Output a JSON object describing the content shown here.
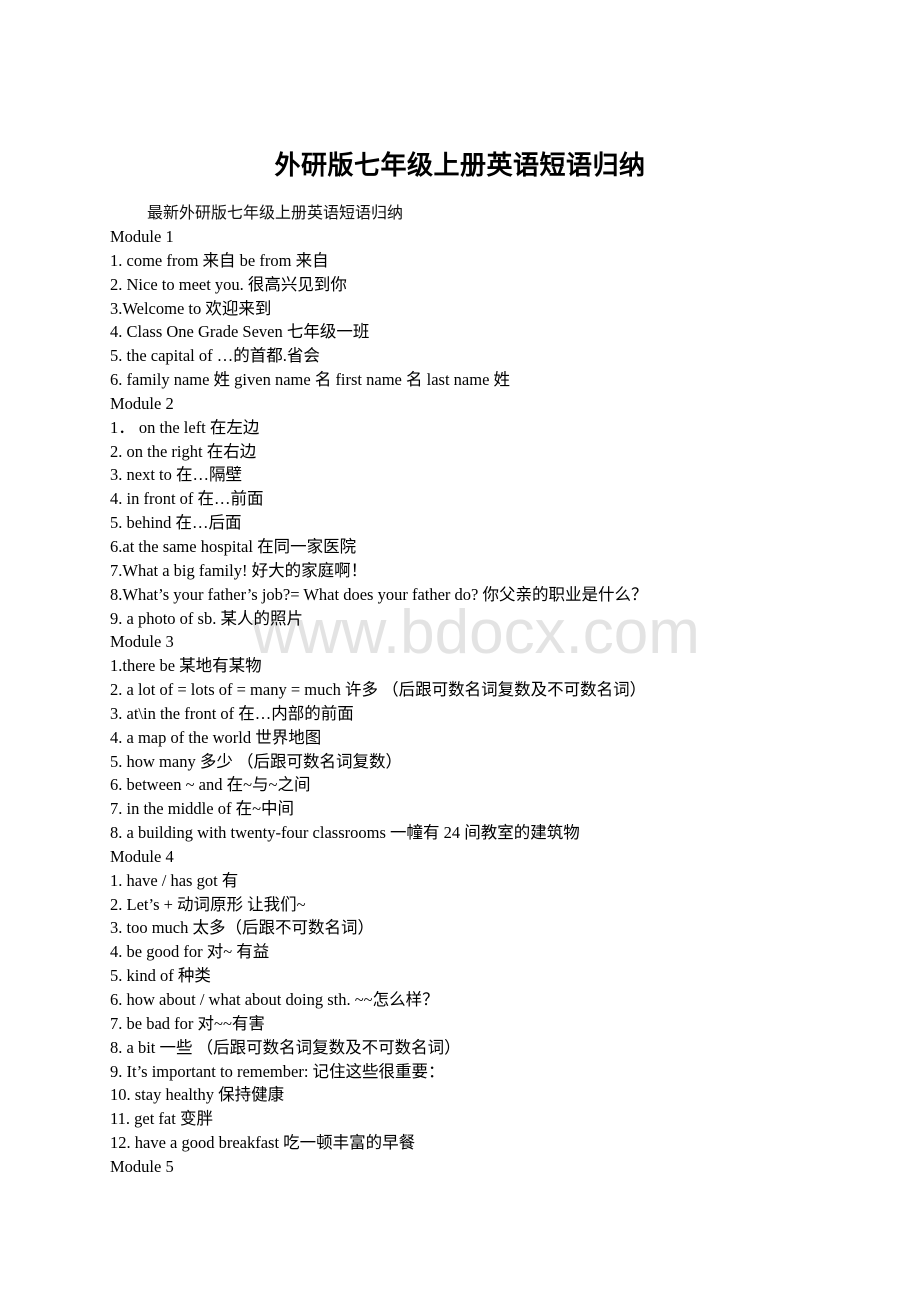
{
  "document": {
    "title": "外研版七年级上册英语短语归纳",
    "intro": "最新外研版七年级上册英语短语归纳",
    "watermark": "www.bdocx.com",
    "lines": [
      {
        "type": "heading",
        "text": "Module 1"
      },
      {
        "type": "item",
        "text": "1. come from 来自 be from 来自"
      },
      {
        "type": "item",
        "text": "2. Nice to meet you. 很高兴见到你"
      },
      {
        "type": "item",
        "text": "3.Welcome to 欢迎来到"
      },
      {
        "type": "item",
        "text": "4. Class One Grade Seven 七年级一班"
      },
      {
        "type": "item",
        "text": "5. the capital of …的首都.省会"
      },
      {
        "type": "item",
        "text": "6. family name 姓 given name 名 first name 名 last name 姓"
      },
      {
        "type": "heading",
        "text": "Module 2"
      },
      {
        "type": "item",
        "text": "1． on the left 在左边"
      },
      {
        "type": "item",
        "text": "2. on the right 在右边"
      },
      {
        "type": "item",
        "text": "3. next to 在…隔壁"
      },
      {
        "type": "item",
        "text": "4. in front of 在…前面"
      },
      {
        "type": "item",
        "text": "5. behind 在…后面"
      },
      {
        "type": "item",
        "text": "6.at the same hospital 在同一家医院"
      },
      {
        "type": "item",
        "text": "7.What a big family! 好大的家庭啊！"
      },
      {
        "type": "item",
        "text": "8.What’s your father’s job?= What does your father do? 你父亲的职业是什么？"
      },
      {
        "type": "item",
        "text": "9. a photo of sb. 某人的照片"
      },
      {
        "type": "heading",
        "text": "Module 3"
      },
      {
        "type": "item",
        "text": "1.there be 某地有某物"
      },
      {
        "type": "item",
        "text": "2. a lot of = lots of = many = much 许多 （后跟可数名词复数及不可数名词）"
      },
      {
        "type": "item",
        "text": "3. at\\in the front of 在…内部的前面"
      },
      {
        "type": "item",
        "text": "4. a map of the world 世界地图"
      },
      {
        "type": "item",
        "text": "5. how many 多少 （后跟可数名词复数）"
      },
      {
        "type": "item",
        "text": "6. between ~ and 在~与~之间"
      },
      {
        "type": "item",
        "text": "7. in the middle of 在~中间"
      },
      {
        "type": "item",
        "text": "8. a building with twenty-four classrooms 一幢有 24 间教室的建筑物"
      },
      {
        "type": "heading",
        "text": "Module 4"
      },
      {
        "type": "item",
        "text": "1. have / has got 有"
      },
      {
        "type": "item",
        "text": "2. Let’s + 动词原形 让我们~"
      },
      {
        "type": "item",
        "text": "3. too much 太多（后跟不可数名词）"
      },
      {
        "type": "item",
        "text": "4. be good for 对~ 有益"
      },
      {
        "type": "item",
        "text": "5. kind of 种类"
      },
      {
        "type": "item",
        "text": "6. how about / what about doing sth. ~~怎么样？"
      },
      {
        "type": "item",
        "text": "7. be bad for 对~~有害"
      },
      {
        "type": "item",
        "text": "8. a bit 一些 （后跟可数名词复数及不可数名词）"
      },
      {
        "type": "item",
        "text": "9. It’s important to remember: 记住这些很重要："
      },
      {
        "type": "item",
        "text": "10. stay healthy 保持健康"
      },
      {
        "type": "item",
        "text": "11. get fat 变胖"
      },
      {
        "type": "item",
        "text": "12. have a good breakfast 吃一顿丰富的早餐"
      },
      {
        "type": "heading",
        "text": "Module 5"
      }
    ]
  }
}
